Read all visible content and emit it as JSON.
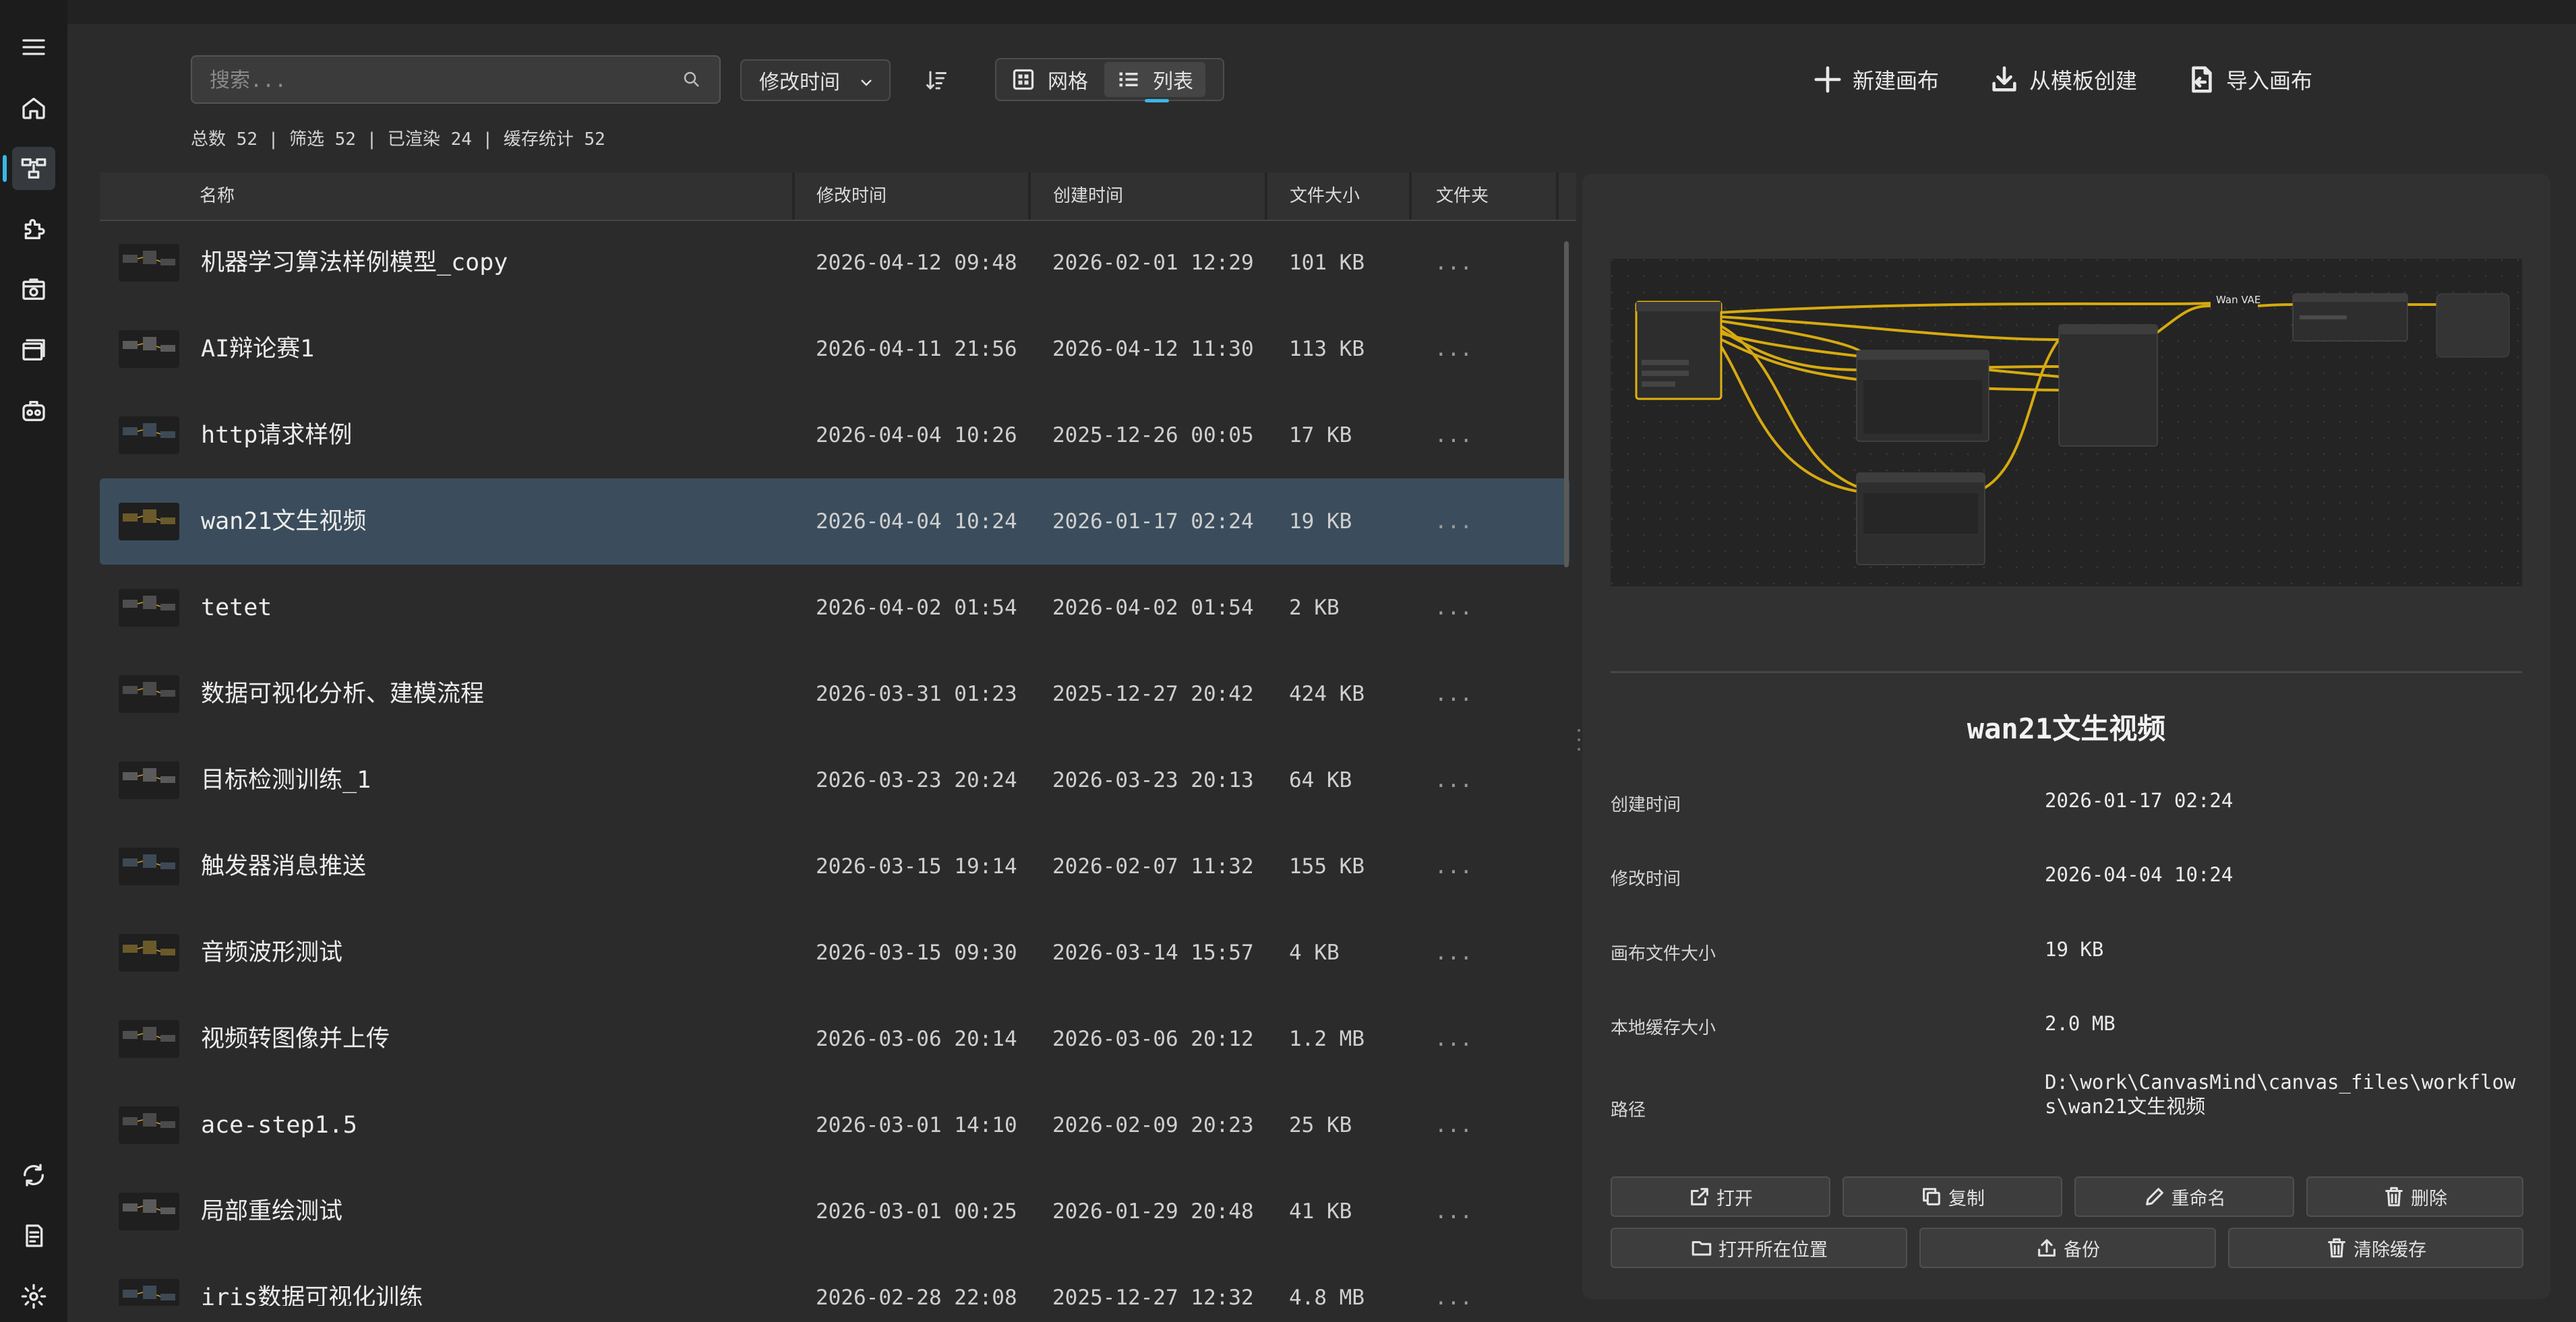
{
  "toolbar": {
    "search_placeholder": "搜索...",
    "sort_field": "修改时间",
    "view_grid_label": "网格",
    "view_list_label": "列表",
    "active_view": "list",
    "new_canvas_label": "新建画布",
    "from_template_label": "从模板创建",
    "import_canvas_label": "导入画布"
  },
  "stats": {
    "total_label": "总数",
    "total": "52",
    "filtered_label": "筛选",
    "filtered": "52",
    "rendered_label": "已渲染",
    "rendered": "24",
    "cache_label": "缓存统计",
    "cache": "52"
  },
  "table": {
    "columns": {
      "name": "名称",
      "modified": "修改时间",
      "created": "创建时间",
      "size": "文件大小",
      "folder": "文件夹"
    },
    "rows": [
      {
        "name": "机器学习算法样例模型_copy",
        "modified": "2026-04-12 09:48",
        "created": "2026-02-01 12:29",
        "size": "101 KB",
        "folder": "..."
      },
      {
        "name": "AI辩论赛1",
        "modified": "2026-04-11 21:56",
        "created": "2026-04-12 11:30",
        "size": "113 KB",
        "folder": "..."
      },
      {
        "name": "http请求样例",
        "modified": "2026-04-04 10:26",
        "created": "2025-12-26 00:05",
        "size": "17 KB",
        "folder": "..."
      },
      {
        "name": "wan21文生视频",
        "modified": "2026-04-04 10:24",
        "created": "2026-01-17 02:24",
        "size": "19 KB",
        "folder": "...",
        "selected": true
      },
      {
        "name": "tetet",
        "modified": "2026-04-02 01:54",
        "created": "2026-04-02 01:54",
        "size": "2 KB",
        "folder": "..."
      },
      {
        "name": "数据可视化分析、建模流程",
        "modified": "2026-03-31 01:23",
        "created": "2025-12-27 20:42",
        "size": "424 KB",
        "folder": "..."
      },
      {
        "name": "目标检测训练_1",
        "modified": "2026-03-23 20:24",
        "created": "2026-03-23 20:13",
        "size": "64 KB",
        "folder": "..."
      },
      {
        "name": "触发器消息推送",
        "modified": "2026-03-15 19:14",
        "created": "2026-02-07 11:32",
        "size": "155 KB",
        "folder": "..."
      },
      {
        "name": "音频波形测试",
        "modified": "2026-03-15 09:30",
        "created": "2026-03-14 15:57",
        "size": "4 KB",
        "folder": "..."
      },
      {
        "name": "视频转图像并上传",
        "modified": "2026-03-06 20:14",
        "created": "2026-03-06 20:12",
        "size": "1.2 MB",
        "folder": "..."
      },
      {
        "name": "ace-step1.5",
        "modified": "2026-03-01 14:10",
        "created": "2026-02-09 20:23",
        "size": "25 KB",
        "folder": "..."
      },
      {
        "name": "局部重绘测试",
        "modified": "2026-03-01 00:25",
        "created": "2026-01-29 20:48",
        "size": "41 KB",
        "folder": "..."
      },
      {
        "name": "iris数据可视化训练",
        "modified": "2026-02-28 22:08",
        "created": "2025-12-27 12:32",
        "size": "4.8 MB",
        "folder": "..."
      }
    ]
  },
  "detail": {
    "title": "wan21文生视频",
    "preview_node_label": "Wan VAE",
    "props": [
      {
        "label": "创建时间",
        "value": "2026-01-17 02:24"
      },
      {
        "label": "修改时间",
        "value": "2026-04-04 10:24"
      },
      {
        "label": "画布文件大小",
        "value": "19 KB"
      },
      {
        "label": "本地缓存大小",
        "value": "2.0 MB"
      },
      {
        "label": "路径",
        "value": "D:\\work\\CanvasMind\\canvas_files\\workflows\\wan21文生视频"
      }
    ],
    "buttons": {
      "open": "打开",
      "copy": "复制",
      "rename": "重命名",
      "delete": "删除",
      "open_location": "打开所在位置",
      "backup": "备份",
      "clear_cache": "清除缓存"
    }
  },
  "colors": {
    "accent": "#39b6e8",
    "selected_row": "#3b4d5c",
    "wire": "#e0b20e"
  }
}
